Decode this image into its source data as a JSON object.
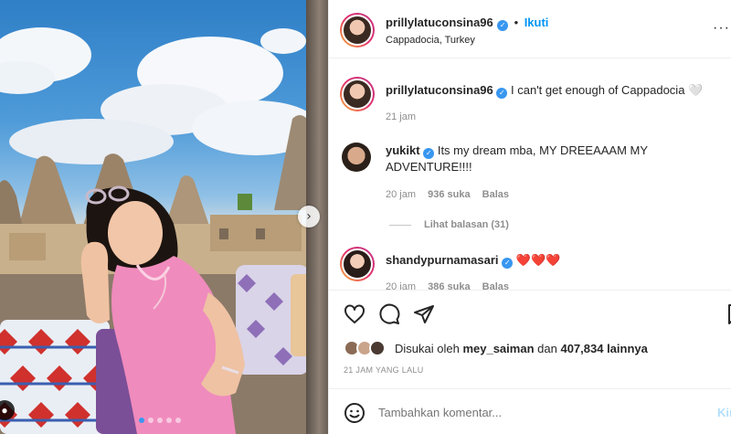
{
  "post": {
    "author": "prillylatuconsina96",
    "follow_label": "Ikuti",
    "location": "Cappadocia, Turkey",
    "caption": "I can't get enough of Cappadocia 🤍",
    "caption_time": "21 jam",
    "more_icon": "more-horizontal-icon"
  },
  "comments": [
    {
      "user": "yukikt",
      "text": "Its my dream mba, MY DREEAAAM MY ADVENTURE!!!!",
      "time": "20 jam",
      "likes": "936 suka",
      "reply_label": "Balas",
      "view_replies": "Lihat balasan (31)"
    },
    {
      "user": "shandypurnamasari",
      "text": "❤️❤️❤️",
      "time": "20 jam",
      "likes": "386 suka",
      "reply_label": "Balas"
    }
  ],
  "likes": {
    "prefix": "Disukai oleh",
    "first_user": "mey_saiman",
    "connector": "dan",
    "others": "407,834 lainnya"
  },
  "timestamp_caps": "21 JAM YANG LALU",
  "composer": {
    "placeholder": "Tambahkan komentar...",
    "post_label": "Kirim"
  },
  "colors": {
    "accent": "#0095f6",
    "verified": "#3897f0",
    "heart": "#ed4956",
    "muted": "#8e8e8e"
  },
  "icons": [
    "heart-icon",
    "comment-icon",
    "share-icon",
    "bookmark-icon",
    "emoji-icon",
    "verified-icon",
    "chevron-right-icon"
  ]
}
